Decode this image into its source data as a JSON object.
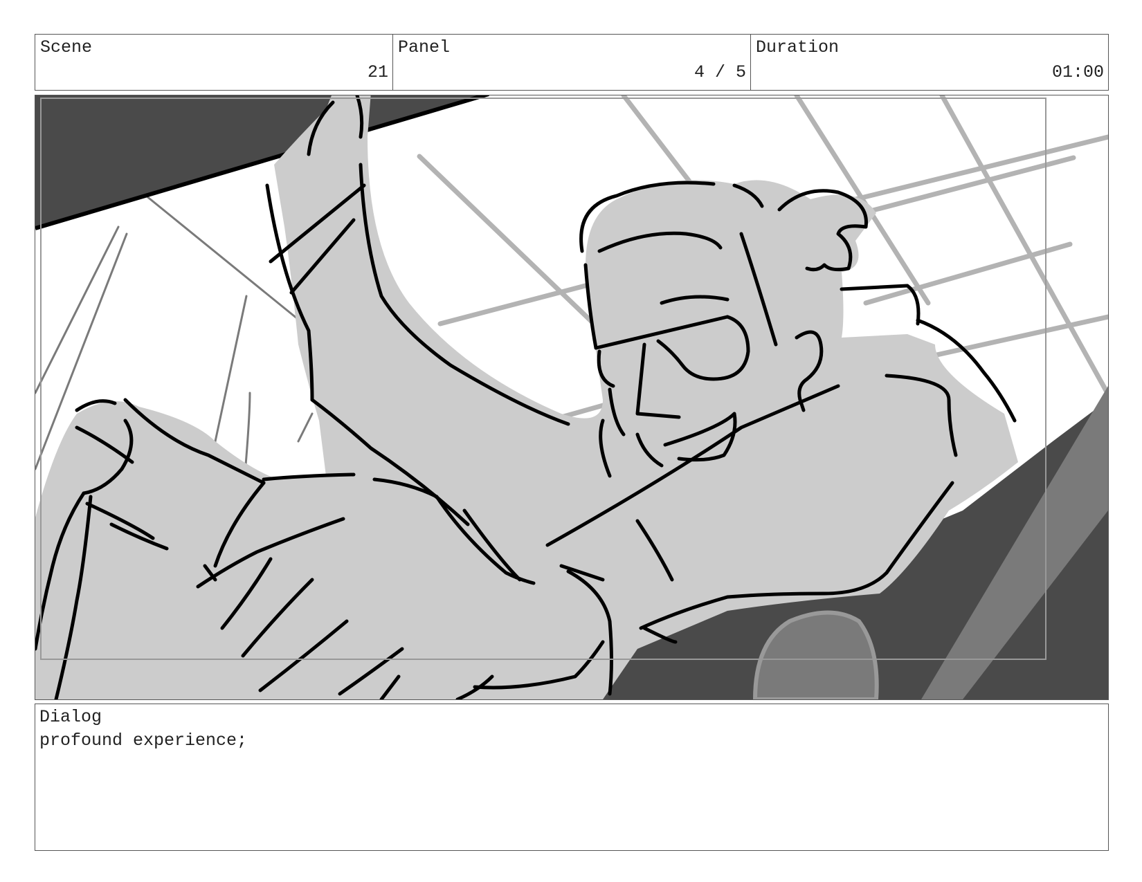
{
  "header": {
    "scene_label": "Scene",
    "scene_value": "21",
    "panel_label": "Panel",
    "panel_value": "4 / 5",
    "duration_label": "Duration",
    "duration_value": "01:00"
  },
  "dialog": {
    "label": "Dialog",
    "text": "profound experience;"
  }
}
